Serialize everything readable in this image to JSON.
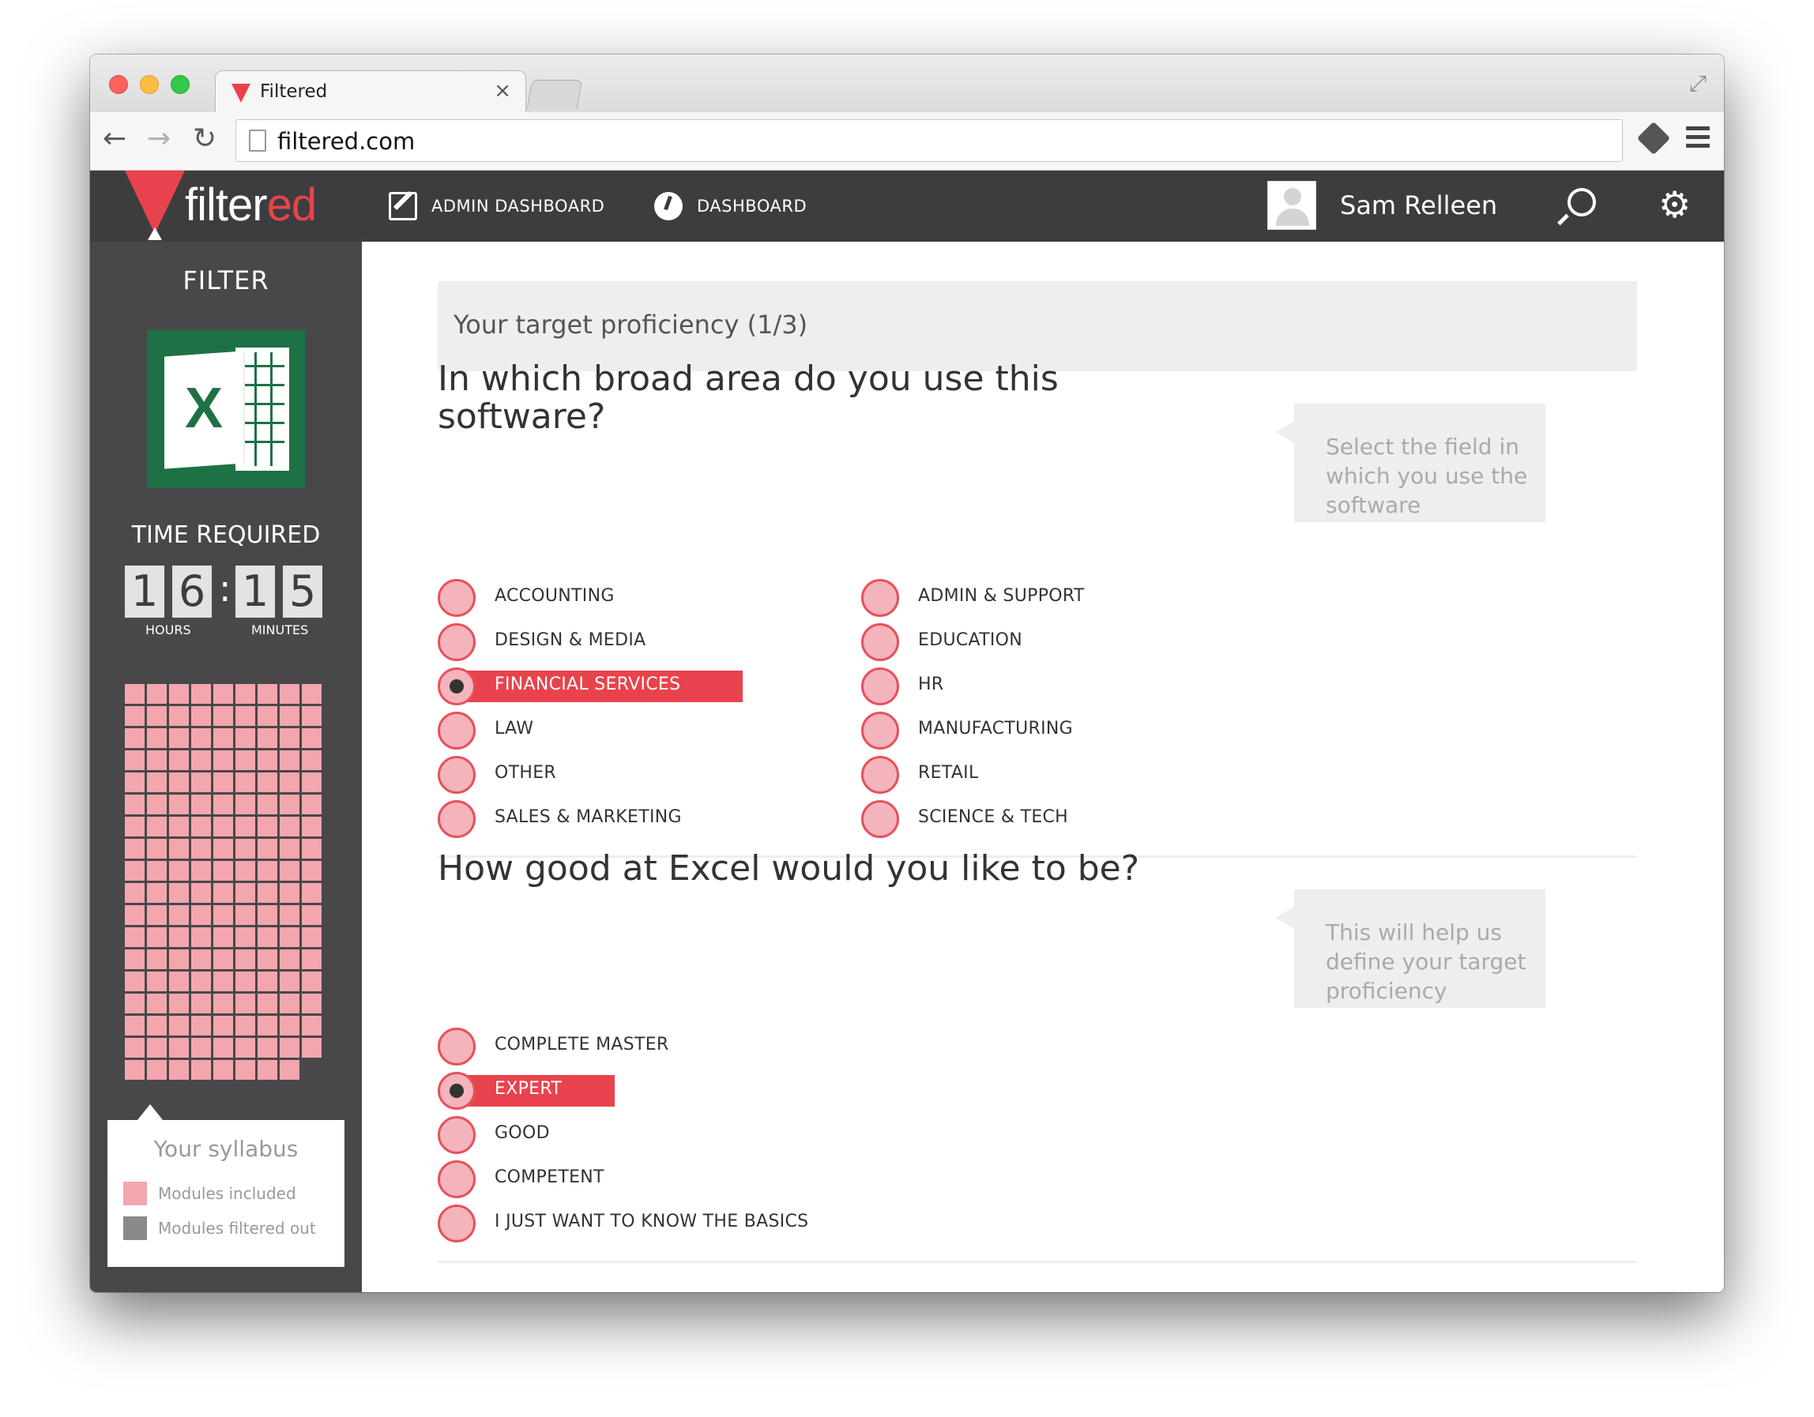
{
  "browser": {
    "tab_title": "Filtered",
    "close_glyph": "×",
    "url": "filtered.com"
  },
  "header": {
    "logo_text_main": "filter",
    "logo_text_accent": "ed",
    "nav": [
      {
        "label": "ADMIN DASHBOARD",
        "icon": "edit-icon"
      },
      {
        "label": "DASHBOARD",
        "icon": "gauge-icon"
      }
    ],
    "user_name": "Sam Relleen"
  },
  "sidebar": {
    "title": "FILTER",
    "app_icon": "excel-icon",
    "time_required_label": "TIME REQUIRED",
    "digits": [
      "1",
      "6",
      "1",
      "5"
    ],
    "hours_label": "HOURS",
    "minutes_label": "MINUTES",
    "legend": {
      "title": "Your syllabus",
      "included_label": "Modules included",
      "filtered_label": "Modules filtered out",
      "included_color": "#f4a6ae",
      "filtered_color": "#8a8a8a"
    }
  },
  "main": {
    "progress_title": "Your target proficiency (1/3)",
    "q1": {
      "title": "In which broad area do you use this software?",
      "tip": "Select the field in which you use the software",
      "selected": "FINANCIAL SERVICES",
      "options_left": [
        "ACCOUNTING",
        "DESIGN & MEDIA",
        "FINANCIAL SERVICES",
        "LAW",
        "OTHER",
        "SALES & MARKETING"
      ],
      "options_right": [
        "ADMIN & SUPPORT",
        "EDUCATION",
        "HR",
        "MANUFACTURING",
        "RETAIL",
        "SCIENCE & TECH"
      ]
    },
    "q2": {
      "title": "How good at Excel would you like to be?",
      "tip": "This will help us define your target proficiency",
      "selected": "EXPERT",
      "options": [
        "COMPLETE MASTER",
        "EXPERT",
        "GOOD",
        "COMPETENT",
        "I JUST WANT TO KNOW THE BASICS"
      ]
    }
  },
  "colors": {
    "accent": "#e8434c",
    "header_bg": "#3d3d3f",
    "sidebar_bg": "#48484a"
  }
}
